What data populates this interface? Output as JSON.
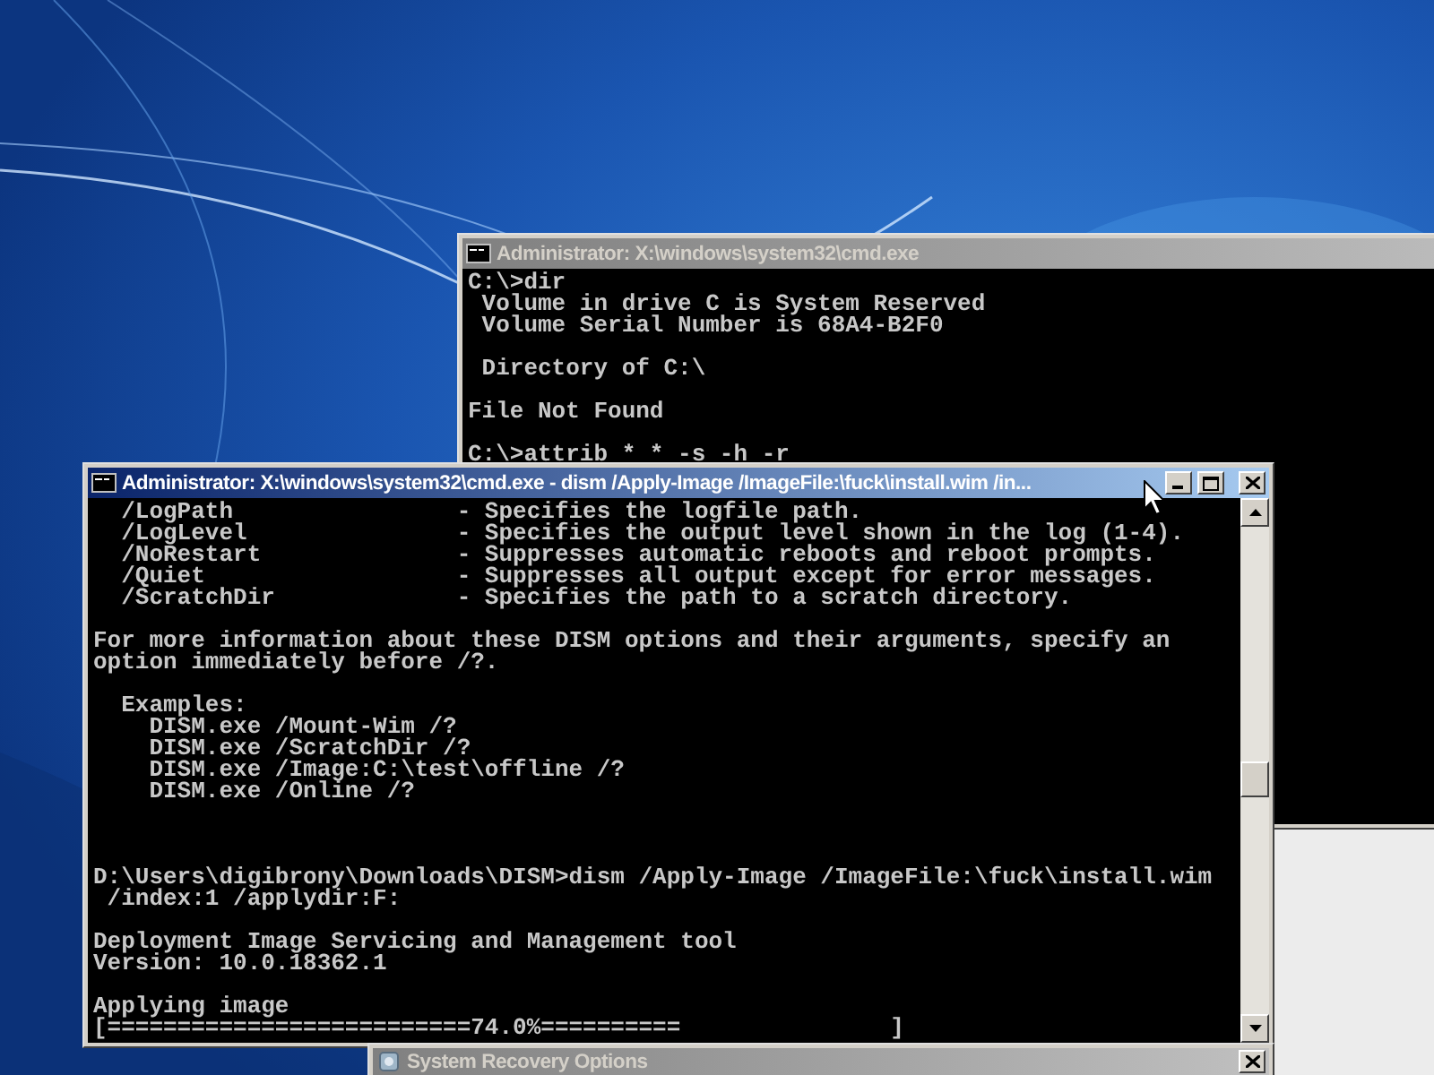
{
  "windows": [
    {
      "kind": "console",
      "title": "Administrator: X:\\windows\\system32\\cmd.exe",
      "active": false,
      "lines": [
        {
          "kind": "text",
          "text": "C:\\>dir"
        },
        {
          "kind": "text",
          "text": " Volume in drive C is System Reserved"
        },
        {
          "kind": "text",
          "text": " Volume Serial Number is 68A4-B2F0"
        },
        {
          "kind": "blank"
        },
        {
          "kind": "text",
          "text": " Directory of C:\\"
        },
        {
          "kind": "blank"
        },
        {
          "kind": "text",
          "text": "File Not Found"
        },
        {
          "kind": "blank"
        },
        {
          "kind": "text",
          "text": "C:\\>attrib * * -s -h -r"
        }
      ]
    },
    {
      "kind": "console",
      "title": "Administrator: X:\\windows\\system32\\cmd.exe - dism  /Apply-Image /ImageFile:\\fuck\\install.wim /in...",
      "active": true,
      "lines": [
        {
          "kind": "text",
          "text": "  /LogPath                - Specifies the logfile path."
        },
        {
          "kind": "text",
          "text": "  /LogLevel               - Specifies the output level shown in the log (1-4)."
        },
        {
          "kind": "text",
          "text": "  /NoRestart              - Suppresses automatic reboots and reboot prompts."
        },
        {
          "kind": "text",
          "text": "  /Quiet                  - Suppresses all output except for error messages."
        },
        {
          "kind": "text",
          "text": "  /ScratchDir             - Specifies the path to a scratch directory."
        },
        {
          "kind": "blank"
        },
        {
          "kind": "text",
          "text": "For more information about these DISM options and their arguments, specify an"
        },
        {
          "kind": "text",
          "text": "option immediately before /?."
        },
        {
          "kind": "blank"
        },
        {
          "kind": "text",
          "text": "  Examples:"
        },
        {
          "kind": "text",
          "text": "    DISM.exe /Mount-Wim /?"
        },
        {
          "kind": "text",
          "text": "    DISM.exe /ScratchDir /?"
        },
        {
          "kind": "text",
          "text": "    DISM.exe /Image:C:\\test\\offline /?"
        },
        {
          "kind": "text",
          "text": "    DISM.exe /Online /?"
        },
        {
          "kind": "blank"
        },
        {
          "kind": "blank"
        },
        {
          "kind": "blank"
        },
        {
          "kind": "text",
          "text": "D:\\Users\\digibrony\\Downloads\\DISM>dism /Apply-Image /ImageFile:\\fuck\\install.wim"
        },
        {
          "kind": "text",
          "text": " /index:1 /applydir:F:"
        },
        {
          "kind": "blank"
        },
        {
          "kind": "text",
          "text": "Deployment Image Servicing and Management tool"
        },
        {
          "kind": "text",
          "text": "Version: 10.0.18362.1"
        },
        {
          "kind": "blank"
        },
        {
          "kind": "text",
          "text": "Applying image"
        },
        {
          "kind": "text",
          "text": "[==========================74.0%==========               ]"
        }
      ]
    },
    {
      "kind": "dialog",
      "title": "System Recovery Options",
      "active": false
    }
  ]
}
